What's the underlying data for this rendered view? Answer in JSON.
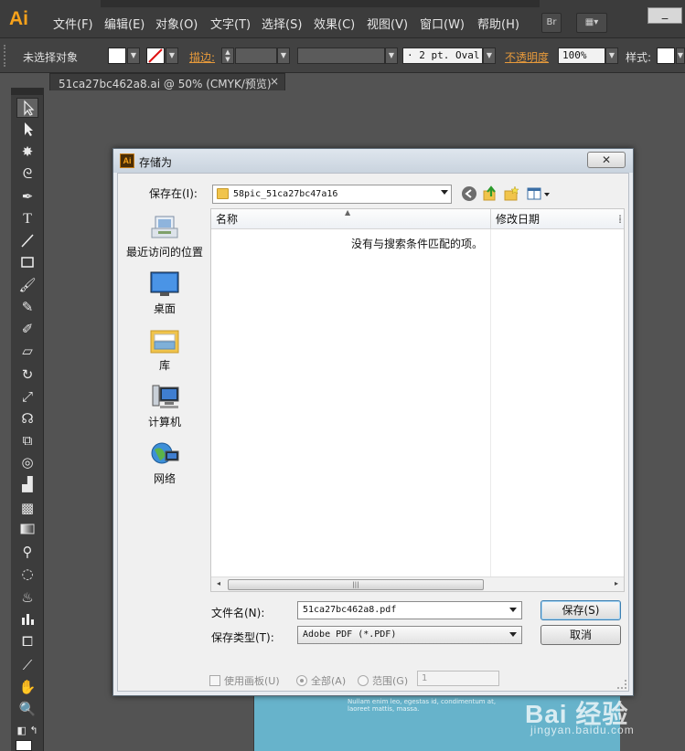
{
  "menubar": {
    "logo": "Ai",
    "items": [
      "文件(F)",
      "编辑(E)",
      "对象(O)",
      "文字(T)",
      "选择(S)",
      "效果(C)",
      "视图(V)",
      "窗口(W)",
      "帮助(H)"
    ],
    "bridge_label": "Br"
  },
  "control_bar": {
    "selection_status": "未选择对象",
    "stroke_label": "描边:",
    "brush_value": "· 2 pt. Oval",
    "opacity_label": "不透明度",
    "opacity_value": "100%",
    "style_label": "样式:"
  },
  "doc_tab": {
    "title": "51ca27bc462a8.ai @ 50% (CMYK/预览)",
    "close": "×"
  },
  "tools": [
    "select-tool",
    "direct-select-tool",
    "magic-wand-tool",
    "lasso-tool",
    "pen-tool",
    "type-tool",
    "line-tool",
    "rectangle-tool",
    "paintbrush-tool",
    "pencil-tool",
    "blob-brush-tool",
    "eraser-tool",
    "rotate-tool",
    "scale-tool",
    "warp-tool",
    "free-transform-tool",
    "shape-builder-tool",
    "perspective-grid-tool",
    "mesh-tool",
    "gradient-tool",
    "eyedropper-tool",
    "blend-tool",
    "symbol-sprayer-tool",
    "column-graph-tool",
    "artboard-tool",
    "slice-tool",
    "hand-tool",
    "zoom-tool"
  ],
  "dialog": {
    "title": "存储为",
    "close": "✕",
    "look_in_label": "保存在(I):",
    "look_in_value": "58pic_51ca27bc47a16",
    "places": [
      {
        "label": "最近访问的位置",
        "icon": "recent-places-icon"
      },
      {
        "label": "桌面",
        "icon": "desktop-icon"
      },
      {
        "label": "库",
        "icon": "libraries-icon"
      },
      {
        "label": "计算机",
        "icon": "computer-icon"
      },
      {
        "label": "网络",
        "icon": "network-icon"
      }
    ],
    "columns": [
      "名称",
      "修改日期"
    ],
    "empty_message": "没有与搜索条件匹配的项。",
    "filename_label": "文件名(N):",
    "filename_value": "51ca27bc462a8.pdf",
    "filetype_label": "保存类型(T):",
    "filetype_value": "Adobe PDF (*.PDF)",
    "save_button": "保存(S)",
    "cancel_button": "取消",
    "use_artboards": "使用画板(U)",
    "all_option": "全部(A)",
    "range_option": "范围(G)",
    "range_value": "1"
  },
  "artboard_text": [
    "Nullam enim leo, egestas id, condimentum at,",
    "laoreet mattis, massa."
  ],
  "watermark": {
    "main": "Bai 经验",
    "sub": "jingyan.baidu.com"
  },
  "colors": {
    "accent": "#f7a21b",
    "link": "#e79a3b",
    "ui_dark": "#3c3c3c",
    "canvas": "#535353",
    "artboard": "#67b3cb"
  }
}
